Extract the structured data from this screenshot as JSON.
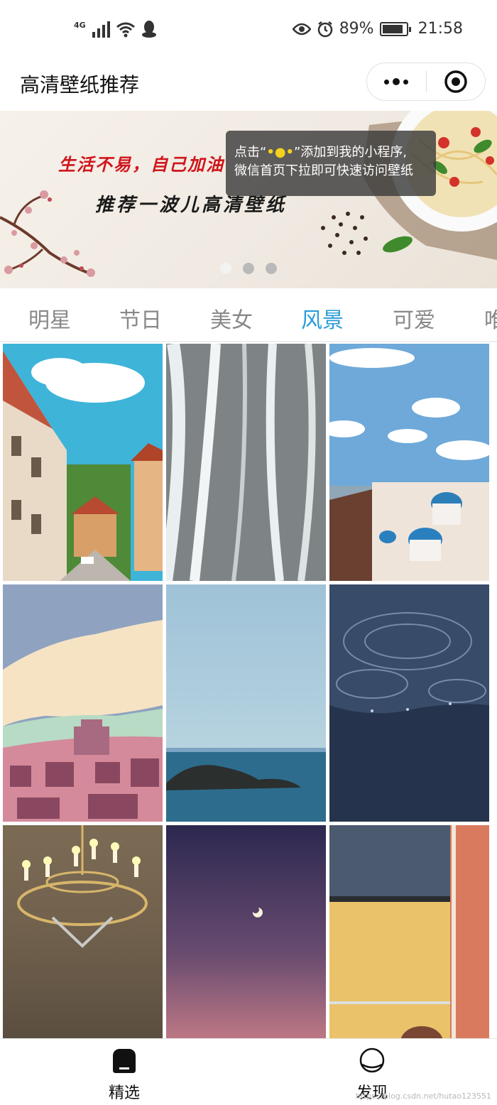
{
  "status_bar": {
    "network": "4G",
    "battery_pct_text": "89%",
    "battery_level": 0.89,
    "time": "21:58",
    "icons": [
      "signal-icon",
      "wifi-icon",
      "qq-icon",
      "eye-icon",
      "alarm-icon",
      "battery-icon"
    ]
  },
  "nav": {
    "title": "高清壁纸推荐",
    "more_icon": "more-dots-icon",
    "close_icon": "target-close-icon"
  },
  "banner": {
    "slogan_line1": "生活不易，自己加油",
    "slogan_line2": "推荐一波儿高清壁纸",
    "tooltip_prefix": "点击“",
    "tooltip_dots": "•●•",
    "tooltip_suffix": "”添加到我的小程序,",
    "tooltip_line2": "微信首页下拉即可快速访问壁纸",
    "dot_count": 3,
    "active_dot": 0
  },
  "categories": {
    "items": [
      "明星",
      "节日",
      "美女",
      "风景",
      "可爱",
      "唯美"
    ],
    "active": 3
  },
  "wallpapers": [
    {
      "name": "town-street",
      "kind": "street"
    },
    {
      "name": "snow-field",
      "kind": "snow"
    },
    {
      "name": "santorini",
      "kind": "santorini"
    },
    {
      "name": "painted-city",
      "kind": "painted"
    },
    {
      "name": "sea-island",
      "kind": "sea"
    },
    {
      "name": "water-ripples",
      "kind": "water"
    },
    {
      "name": "chandelier",
      "kind": "chandelier"
    },
    {
      "name": "dusk-moon",
      "kind": "dusk"
    },
    {
      "name": "yellow-wall",
      "kind": "wall"
    }
  ],
  "tabbar": {
    "items": [
      {
        "label": "精选",
        "icon": "home-icon"
      },
      {
        "label": "发现",
        "icon": "discover-icon"
      }
    ],
    "active": 0
  },
  "watermark": "https://blog.csdn.net/hutao123551",
  "colors": {
    "accent": "#2a9bd8",
    "inactive_tab": "#888888",
    "tooltip_bg": "#3c3c3c",
    "tooltip_highlight": "#f4d21e"
  }
}
